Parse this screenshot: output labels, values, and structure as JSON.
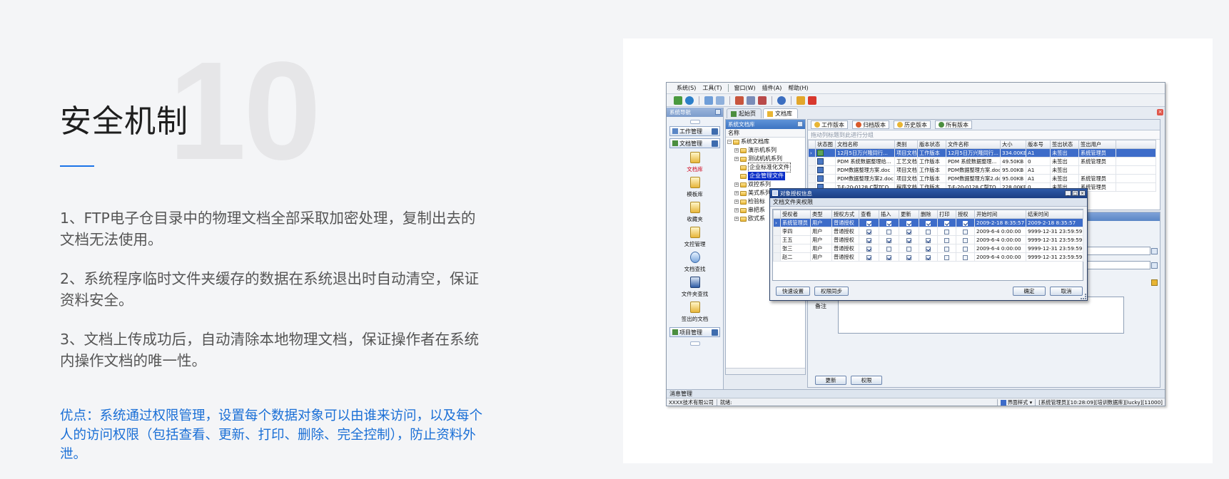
{
  "slide": {
    "number": "10",
    "title": "安全机制",
    "points": [
      "1、FTP电子仓目录中的物理文档全部采取加密处理，复制出去的文档无法使用。",
      "2、系统程序临时文件夹缓存的数据在系统退出时自动清空，保证资料安全。",
      "3、文档上传成功后，自动清除本地物理文档，保证操作者在系统内操作文档的唯一性。"
    ],
    "note": "优点：系统通过权限管理，设置每个数据对象可以由谁来访问，以及每个人的访问权限（包括查看、更新、打印、删除、完全控制），防止资料外泄。",
    "colors": {
      "accent": "#1a73e8",
      "note": "#1a6fd6"
    }
  },
  "app": {
    "menu": [
      "系统(S)",
      "工具(T)",
      "窗口(W)",
      "插件(A)",
      "帮助(H)"
    ],
    "tabs": [
      "起始页",
      "文档库"
    ],
    "nav": {
      "header": "系统导航",
      "groups": [
        "工作管理",
        "文档管理",
        "项目管理"
      ],
      "items": [
        "文档库",
        "模板库",
        "收藏夹",
        "文控管理",
        "文档查找",
        "文件夹查找",
        "签出的文档"
      ]
    },
    "tree": {
      "header": "系统文档库",
      "column": "名称",
      "root": "系统文档库",
      "nodes": [
        "演示机系列",
        "测试机机系列",
        "企业标准化文件",
        "企业管理文件",
        "双控系列",
        "美式系列",
        "检验标",
        "串把系",
        "欧式系"
      ]
    },
    "docs": {
      "tabs": [
        "工作版本",
        "归档版本",
        "历史版本",
        "所有版本"
      ],
      "group_hint": "拖动列标题到此进行分组",
      "columns": [
        "状态图",
        "文档名称",
        "类别",
        "版本状态",
        "文件名称",
        "大小",
        "版本号",
        "签出状态",
        "签出用户"
      ],
      "rows": [
        [
          "",
          "12月5日万兴隆同行...",
          "项目文档",
          "工作版本",
          "12月5日万兴隆同行...",
          "334.00KB",
          "A1",
          "未签出",
          "系统管理员"
        ],
        [
          "",
          "PDM 系统数据整理给...",
          "工艺文档",
          "工作版本",
          "PDM 系统数据整理...",
          "49.50KB",
          "0",
          "未签出",
          "系统管理员"
        ],
        [
          "",
          "PDM数据整理方案.doc",
          "项目文档",
          "工作版本",
          "PDM数据整理方案.doc",
          "95.00KB",
          "A1",
          "未签出",
          ""
        ],
        [
          "",
          "PDM数据整理方案2.doc",
          "项目文档",
          "工作版本",
          "PDM数据整理方案2.doc",
          "95.00KB",
          "A1",
          "未签出",
          "系统管理员"
        ],
        [
          "",
          "T-F-20-0128 C型TCO...",
          "程序文档",
          "工作版本",
          "T-F-20-0128 C型TO...",
          "228.00KB",
          "0",
          "未签出",
          "系统管理员"
        ]
      ]
    },
    "props": {
      "memo_label": "备注",
      "buttons": [
        "更新",
        "权限"
      ]
    },
    "dialog": {
      "title": "对象授权信息",
      "subtitle": "文档文件夹权限",
      "columns": [
        "受权者",
        "类型",
        "授权方式",
        "查看",
        "插入",
        "更新",
        "删除",
        "打印",
        "授权",
        "开始时间",
        "结束时间"
      ],
      "rows": [
        {
          "name": "系统管理员",
          "type": "用户",
          "mode": "普通授权",
          "perms": [
            true,
            true,
            true,
            true,
            true,
            true
          ],
          "start": "2009-2-18 8:35:57",
          "end": "2009-2-18 8:35:57"
        },
        {
          "name": "李四",
          "type": "用户",
          "mode": "普通授权",
          "perms": [
            true,
            false,
            true,
            false,
            false,
            false
          ],
          "start": "2009-6-4 0:00:00",
          "end": "9999-12-31 23:59:59"
        },
        {
          "name": "王五",
          "type": "用户",
          "mode": "普通授权",
          "perms": [
            true,
            true,
            true,
            true,
            false,
            false
          ],
          "start": "2009-6-4 0:00:00",
          "end": "9999-12-31 23:59:59"
        },
        {
          "name": "张三",
          "type": "用户",
          "mode": "普通授权",
          "perms": [
            true,
            false,
            false,
            true,
            false,
            false
          ],
          "start": "2009-6-4 0:00:00",
          "end": "9999-12-31 23:59:59"
        },
        {
          "name": "赵二",
          "type": "用户",
          "mode": "普通授权",
          "perms": [
            true,
            true,
            true,
            true,
            false,
            false
          ],
          "start": "2009-6-4 0:00:00",
          "end": "9999-12-31 23:59:59"
        }
      ],
      "buttons": [
        "快速设置",
        "权限同步",
        "确定",
        "取消"
      ]
    },
    "message_tab": "消息管理",
    "status": {
      "company": "XXXX技术有限公司",
      "state": "就绪:",
      "style": "界面样式",
      "info": "[系统管理员][10:28:09][培训数据库][lucky][11000]"
    }
  }
}
